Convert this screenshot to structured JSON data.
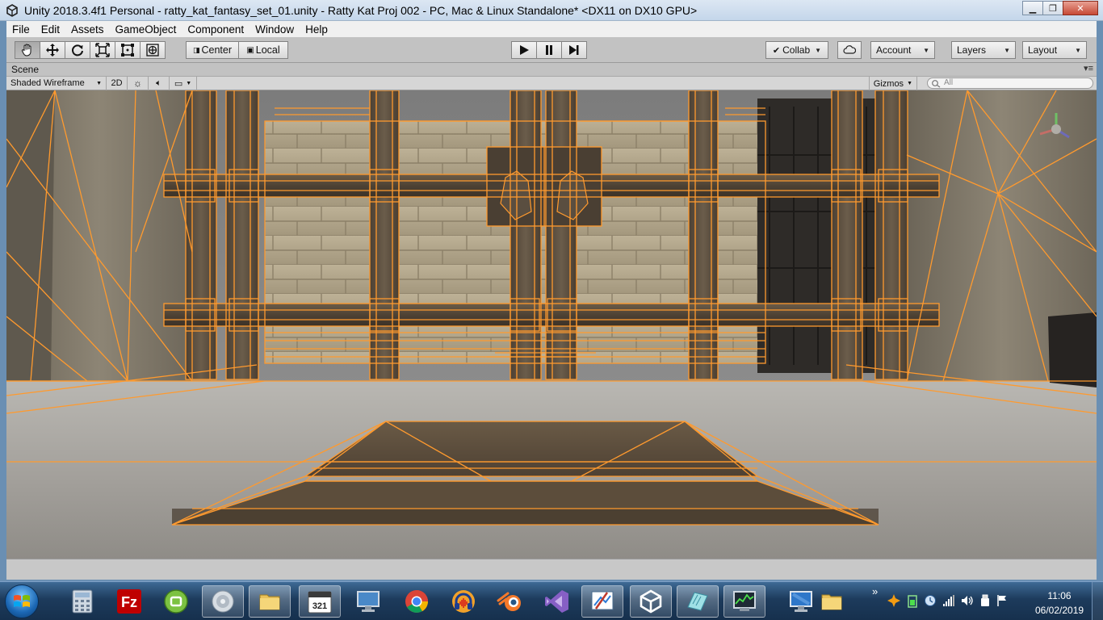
{
  "window": {
    "title": "Unity 2018.3.4f1 Personal - ratty_kat_fantasy_set_01.unity - Ratty Kat Proj 002 - PC, Mac & Linux Standalone* <DX11 on DX10 GPU>",
    "minimize_glyph": "▁",
    "maximize_glyph": "❐",
    "close_glyph": "✕"
  },
  "menu": [
    "File",
    "Edit",
    "Assets",
    "GameObject",
    "Component",
    "Window",
    "Help"
  ],
  "toolbar": {
    "tools": [
      {
        "name": "hand-tool",
        "icon": "hand-icon"
      },
      {
        "name": "move-tool",
        "icon": "move-arrows-icon"
      },
      {
        "name": "rotate-tool",
        "icon": "rotate-icon"
      },
      {
        "name": "scale-tool",
        "icon": "scale-icon"
      },
      {
        "name": "rect-tool",
        "icon": "rect-icon"
      },
      {
        "name": "transform-tool",
        "icon": "transform-icon"
      }
    ],
    "pivot_label": "Center",
    "space_label": "Local",
    "play_icon": "play-icon",
    "pause_icon": "pause-icon",
    "step_icon": "step-icon",
    "collab_label": "Collab",
    "cloud_icon": "cloud-icon",
    "account_label": "Account",
    "layers_label": "Layers",
    "layout_label": "Layout"
  },
  "scene": {
    "tab_label": "Scene",
    "tab_menu_glyph": "▾≡",
    "shading_mode": "Shaded Wireframe",
    "mode_2d_label": "2D",
    "lighting_icon": "sun-icon",
    "audio_icon": "speaker-icon",
    "effects_icon": "image-icon",
    "gizmos_label": "Gizmos",
    "search_placeholder": "All",
    "colors": {
      "wireframe": "#ff9a2e",
      "floor": "#9a9896",
      "wall": "#b7a98d",
      "pillar": "#5e5142",
      "rock": "#7a7466"
    }
  },
  "taskbar": {
    "apps": [
      {
        "name": "calculator",
        "icon": "calculator-icon"
      },
      {
        "name": "filezilla",
        "icon": "filezilla-icon"
      },
      {
        "name": "greenshot",
        "icon": "green-circle-icon"
      },
      {
        "name": "media-player",
        "icon": "disc-icon"
      },
      {
        "name": "file-explorer",
        "icon": "folder-icon"
      },
      {
        "name": "calendar",
        "icon": "calendar-icon",
        "label": "321"
      },
      {
        "name": "remote-desktop",
        "icon": "monitor-icon"
      },
      {
        "name": "chrome",
        "icon": "chrome-icon"
      },
      {
        "name": "audacity",
        "icon": "headphones-icon"
      },
      {
        "name": "blender",
        "icon": "blender-icon"
      },
      {
        "name": "visual-studio",
        "icon": "visual-studio-icon"
      },
      {
        "name": "paint",
        "icon": "paint-icon"
      },
      {
        "name": "unity",
        "icon": "unity-icon"
      },
      {
        "name": "notes",
        "icon": "notes-icon"
      },
      {
        "name": "task-manager",
        "icon": "task-manager-icon"
      },
      {
        "name": "computer",
        "icon": "computer-icon"
      },
      {
        "name": "folder",
        "icon": "folder-icon"
      }
    ],
    "time": "11:06",
    "date": "06/02/2019",
    "tray_expand_glyph": "»"
  }
}
